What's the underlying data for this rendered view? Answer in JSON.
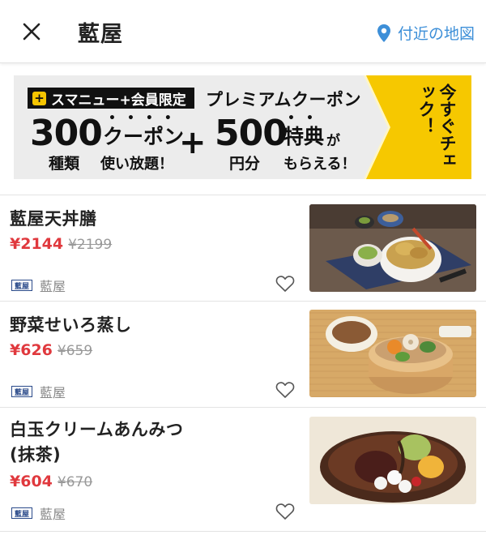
{
  "header": {
    "title": "藍屋",
    "map_link": "付近の地図",
    "accent_color": "#3d8fd8"
  },
  "banner": {
    "badge_plus": "+",
    "badge": "スマニュー+会員限定",
    "premium": "プレミアムクーポン",
    "num1": "300",
    "num1_unit": "種類",
    "coupon_word": "クーポン",
    "unlimited": "使い放題！",
    "plus": "+",
    "num2": "500",
    "num2_unit": "円分",
    "tokuten": "特典",
    "ga": "が",
    "moraeru": "もらえる！",
    "cta": "今すぐチェック！",
    "cta_color": "#f6c800"
  },
  "items": [
    {
      "name": "藍屋天丼膳",
      "price": "¥2144",
      "original_price": "¥2199",
      "shop_logo": "藍屋",
      "shop": "藍屋",
      "image": "tendon-set-photo"
    },
    {
      "name": "野菜せいろ蒸し",
      "price": "¥626",
      "original_price": "¥659",
      "shop_logo": "藍屋",
      "shop": "藍屋",
      "image": "steamed-vegetables-photo"
    },
    {
      "name": "白玉クリームあんみつ(抹茶)",
      "name_line1": "白玉クリームあんみつ",
      "name_line2": "(抹茶)",
      "price": "¥604",
      "original_price": "¥670",
      "shop_logo": "藍屋",
      "shop": "藍屋",
      "image": "anmitsu-photo"
    }
  ],
  "colors": {
    "price": "#e0393e",
    "strike": "#999999"
  }
}
